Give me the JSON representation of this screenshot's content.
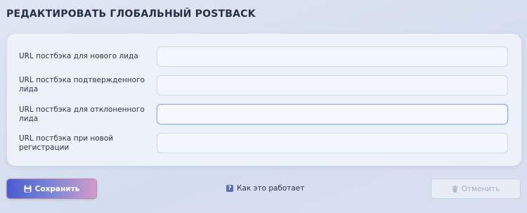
{
  "page": {
    "title": "РЕДАКТИРОВАТЬ ГЛОБАЛЬНЫЙ POSTBACK"
  },
  "form": {
    "rows": [
      {
        "label": "URL постбэка для нового лида",
        "value": "",
        "focused": false
      },
      {
        "label": "URL постбэка подтвержденного лида",
        "value": "",
        "focused": false
      },
      {
        "label": "URL постбэка для отклоненного лида",
        "value": "",
        "focused": true
      },
      {
        "label": "URL постбэка при новой регистрации",
        "value": "",
        "focused": false
      }
    ]
  },
  "actions": {
    "save_label": "Сохранить",
    "help_label": "Как это работает",
    "cancel_label": "Отменить"
  },
  "icons": {
    "save": "floppy-disk-icon",
    "help": "question-mark-icon",
    "cancel": "trash-icon"
  },
  "colors": {
    "save_gradient_start": "#4a5bd0",
    "save_gradient_end": "#d29bcf",
    "focus_border": "#8fb0e2",
    "help_icon_bg": "#5d6fae"
  }
}
